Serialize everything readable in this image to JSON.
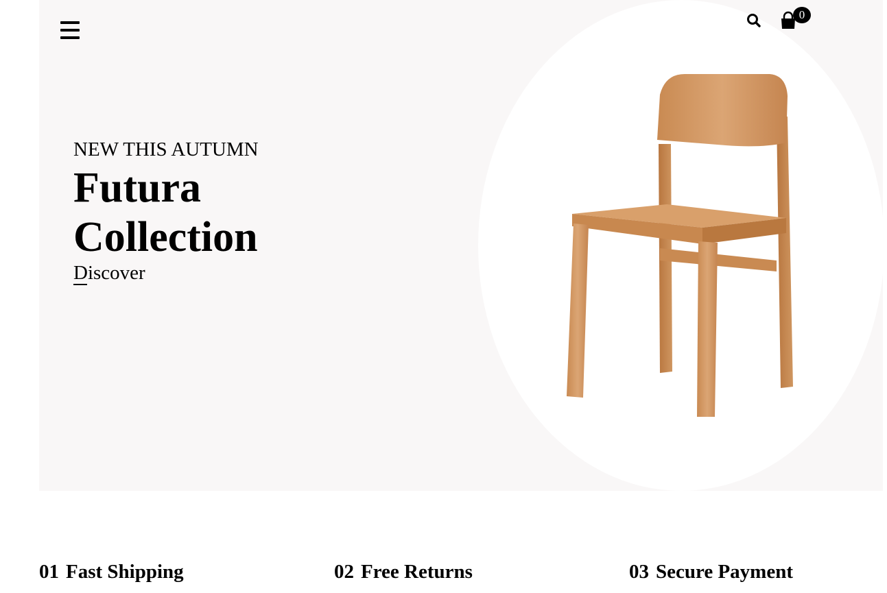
{
  "header": {
    "menu_icon": "hamburger-menu-icon",
    "search_icon": "search-icon",
    "cart_icon": "shopping-bag-icon",
    "cart_count": "0"
  },
  "hero": {
    "kicker": "NEW THIS AUTUMN",
    "title_line1": "Futura",
    "title_line2": "Collection",
    "cta_label": "Discover",
    "background_color": "#f9f7f7",
    "image": "wooden-chair-image"
  },
  "features": [
    {
      "number": "01",
      "label": "Fast Shipping"
    },
    {
      "number": "02",
      "label": "Free Returns"
    },
    {
      "number": "03",
      "label": "Secure Payment"
    }
  ]
}
